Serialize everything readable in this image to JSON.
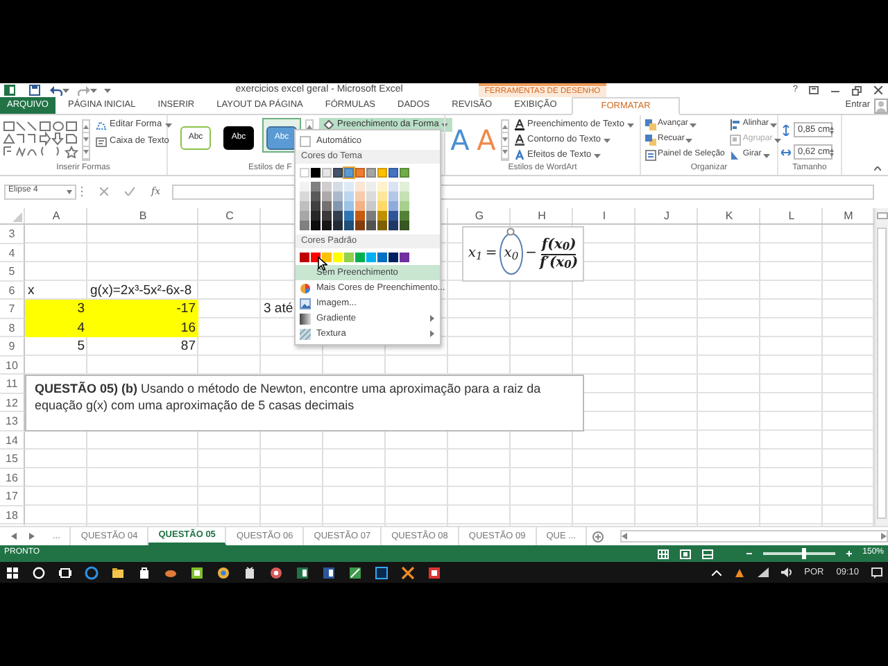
{
  "window": {
    "title": "exercicios excel geral - Microsoft Excel",
    "contextual_group": "FERRAMENTAS DE DESENHO",
    "help": "?"
  },
  "ribbon_tabs": [
    {
      "label": "ARQUIVO",
      "kind": "file",
      "selected": false
    },
    {
      "label": "PÁGINA INICIAL",
      "kind": "plain",
      "selected": false
    },
    {
      "label": "INSERIR",
      "kind": "plain",
      "selected": false
    },
    {
      "label": "LAYOUT DA PÁGINA",
      "kind": "plain",
      "selected": false
    },
    {
      "label": "FÓRMULAS",
      "kind": "plain",
      "selected": false
    },
    {
      "label": "DADOS",
      "kind": "plain",
      "selected": false
    },
    {
      "label": "REVISÃO",
      "kind": "plain",
      "selected": false
    },
    {
      "label": "EXIBIÇÃO",
      "kind": "plain",
      "selected": false
    },
    {
      "label": "FORMATAR",
      "kind": "contextual",
      "selected": true
    }
  ],
  "account": "Entrar",
  "insert_shapes": {
    "label": "Inserir Formas",
    "commands": [
      "Editar Forma",
      "Caixa de Texto"
    ]
  },
  "shape_styles": {
    "label": "Estilos de F",
    "presets": [
      {
        "text": "Abc",
        "kind": "outline",
        "selected": false
      },
      {
        "text": "Abc",
        "kind": "dark",
        "selected": false
      },
      {
        "text": "Abc",
        "kind": "blue",
        "selected": true
      }
    ],
    "fill_button": {
      "label": "Preenchimento da Forma",
      "expanded": true
    }
  },
  "wordart": {
    "label": "Estilos de WordArt",
    "presets": [
      {
        "text": "A",
        "color": "#4a8fd4"
      },
      {
        "text": "A",
        "color": "#ef8a4a"
      }
    ],
    "commands": [
      {
        "label": "Preenchimento de Texto",
        "kind": "fill"
      },
      {
        "label": "Contorno do Texto",
        "kind": "outline"
      },
      {
        "label": "Efeitos de Texto",
        "kind": "effects"
      }
    ]
  },
  "arrange": {
    "label": "Organizar",
    "commands": [
      {
        "label": "Avançar",
        "kind": "forward",
        "disabled": false,
        "dropdown": true
      },
      {
        "label": "Recuar",
        "kind": "backward",
        "disabled": false,
        "dropdown": true
      },
      {
        "label": "Painel de Seleção",
        "kind": "pane",
        "disabled": false,
        "dropdown": false
      },
      {
        "label": "Alinhar",
        "kind": "align",
        "disabled": false,
        "dropdown": true
      },
      {
        "label": "Agrupar",
        "kind": "group",
        "disabled": true,
        "dropdown": true
      },
      {
        "label": "Girar",
        "kind": "rotate",
        "disabled": false,
        "dropdown": true
      }
    ]
  },
  "size": {
    "label": "Tamanho",
    "fields": [
      {
        "value": "0,85 cm",
        "kind": "height"
      },
      {
        "value": "0,62 cm",
        "kind": "width"
      }
    ]
  },
  "name_box": "Elipse 4",
  "formula_bar": {
    "fx": "fx"
  },
  "columns": [
    "A",
    "B",
    "C",
    null,
    null,
    null,
    "G",
    "H",
    "I",
    "J",
    "K",
    "L",
    "M"
  ],
  "rows": [
    {
      "number": "3"
    },
    {
      "number": "4"
    },
    {
      "number": "5"
    },
    {
      "number": "6",
      "cells": {
        "A": {
          "text": "x",
          "kind": "text",
          "highlighted": false
        },
        "B": {
          "text": "g(x)=2x³-5x²-6x-8",
          "kind": "text",
          "highlighted": false
        }
      }
    },
    {
      "number": "7",
      "cells": {
        "A": {
          "text": "3",
          "kind": "number",
          "highlighted": true
        },
        "B": {
          "text": "-17",
          "kind": "number",
          "highlighted": true
        },
        "D": {
          "text": "3 até",
          "highlighted": false
        }
      }
    },
    {
      "number": "8",
      "cells": {
        "A": {
          "text": "4",
          "kind": "number",
          "highlighted": true
        },
        "B": {
          "text": "16",
          "kind": "number",
          "highlighted": true
        }
      }
    },
    {
      "number": "9",
      "cells": {
        "A": {
          "text": "5",
          "kind": "number",
          "highlighted": false
        },
        "B": {
          "text": "87",
          "kind": "number",
          "highlighted": false
        }
      }
    },
    {
      "number": "10"
    },
    {
      "number": "11"
    },
    {
      "number": "12"
    },
    {
      "number": "13"
    },
    {
      "number": "14"
    },
    {
      "number": "15"
    },
    {
      "number": "16"
    },
    {
      "number": "17"
    },
    {
      "number": "18"
    }
  ],
  "equation": {
    "lhs": "x$_{1}$",
    "equals": "=",
    "term": "x$_{0}$",
    "minus": "−",
    "numerator": "f(x$_{0}$)",
    "denominator": "f′(x$_{0}$)"
  },
  "question_box": {
    "text": "**QUESTÃO 05) (b)** Usando o método de Newton, encontre uma aproximação para a raiz da equação g(x) com uma aproximação de 5 casas decimais"
  },
  "fill_menu": {
    "items": [
      {
        "kind": "auto",
        "label": "Automático",
        "selected": false
      },
      {
        "kind": "heading",
        "label": "Cores do Tema"
      },
      {
        "kind": "theme_palette"
      },
      {
        "kind": "heading",
        "label": "Cores Padrão"
      },
      {
        "kind": "standard_palette"
      },
      {
        "kind": "none",
        "label": "Sem Preenchimento",
        "selected": true
      },
      {
        "kind": "more_colors",
        "label": "Mais Cores de Preenchimento...",
        "selected": false
      },
      {
        "kind": "picture",
        "label": "Imagem...",
        "selected": false
      },
      {
        "kind": "gradient",
        "label": "Gradiente",
        "selected": false,
        "submenu": true
      },
      {
        "kind": "texture",
        "label": "Textura",
        "selected": false,
        "submenu": true
      }
    ],
    "theme_colors": [
      {
        "color": "#ffffff",
        "selected": false,
        "shades": [
          {
            "color": "#f2f2f2"
          },
          {
            "color": "#d9d9d9"
          },
          {
            "color": "#bfbfbf"
          },
          {
            "color": "#a6a6a6"
          },
          {
            "color": "#808080"
          }
        ]
      },
      {
        "color": "#000000",
        "selected": false,
        "shades": [
          {
            "color": "#808080"
          },
          {
            "color": "#595959"
          },
          {
            "color": "#404040"
          },
          {
            "color": "#262626"
          },
          {
            "color": "#0d0d0d"
          }
        ]
      },
      {
        "color": "#e7e6e6",
        "selected": false,
        "shades": [
          {
            "color": "#d0cece"
          },
          {
            "color": "#aeaaaa"
          },
          {
            "color": "#757171"
          },
          {
            "color": "#3a3838"
          },
          {
            "color": "#171616"
          }
        ]
      },
      {
        "color": "#44546a",
        "selected": false,
        "shades": [
          {
            "color": "#d6dce4"
          },
          {
            "color": "#acb9ca"
          },
          {
            "color": "#8497b0"
          },
          {
            "color": "#333f4f"
          },
          {
            "color": "#222a35"
          }
        ]
      },
      {
        "color": "#5b9bd5",
        "selected": true,
        "shades": [
          {
            "color": "#deebf6"
          },
          {
            "color": "#bdd7ee"
          },
          {
            "color": "#9dc3e6"
          },
          {
            "color": "#2e75b5"
          },
          {
            "color": "#1f4e79"
          }
        ]
      },
      {
        "color": "#ed7d31",
        "selected": false,
        "shades": [
          {
            "color": "#fbe5d5"
          },
          {
            "color": "#f7cbac"
          },
          {
            "color": "#f4b183"
          },
          {
            "color": "#c55a11"
          },
          {
            "color": "#843c0b"
          }
        ]
      },
      {
        "color": "#a5a5a5",
        "selected": false,
        "shades": [
          {
            "color": "#ededed"
          },
          {
            "color": "#dbdbdb"
          },
          {
            "color": "#c9c9c9"
          },
          {
            "color": "#7b7b7b"
          },
          {
            "color": "#525252"
          }
        ]
      },
      {
        "color": "#ffc000",
        "selected": false,
        "shades": [
          {
            "color": "#fff2cc"
          },
          {
            "color": "#ffe699"
          },
          {
            "color": "#ffd966"
          },
          {
            "color": "#bf9000"
          },
          {
            "color": "#7f6000"
          }
        ]
      },
      {
        "color": "#4472c4",
        "selected": false,
        "shades": [
          {
            "color": "#dae3f3"
          },
          {
            "color": "#b4c7e7"
          },
          {
            "color": "#8faadc"
          },
          {
            "color": "#2f5597"
          },
          {
            "color": "#1f3864"
          }
        ]
      },
      {
        "color": "#70ad47",
        "selected": false,
        "shades": [
          {
            "color": "#e2efd9"
          },
          {
            "color": "#c5e0b3"
          },
          {
            "color": "#a8d08d"
          },
          {
            "color": "#538135"
          },
          {
            "color": "#375623"
          }
        ]
      }
    ],
    "standard_colors": [
      {
        "color": "#c00000"
      },
      {
        "color": "#ff0000"
      },
      {
        "color": "#ffc000"
      },
      {
        "color": "#ffff00"
      },
      {
        "color": "#92d050"
      },
      {
        "color": "#00b050"
      },
      {
        "color": "#00b0f0"
      },
      {
        "color": "#0070c0"
      },
      {
        "color": "#002060"
      },
      {
        "color": "#7030a0"
      }
    ]
  },
  "sheet_tabs": {
    "more": "...",
    "tabs": [
      {
        "label": "QUESTÃO 04",
        "selected": false
      },
      {
        "label": "QUESTÃO 05",
        "selected": true
      },
      {
        "label": "QUESTÃO 06",
        "selected": false
      },
      {
        "label": "QUESTÃO 07",
        "selected": false
      },
      {
        "label": "QUESTÃO 08",
        "selected": false
      },
      {
        "label": "QUESTÃO 09",
        "selected": false
      },
      {
        "label": "QUE ...",
        "selected": false
      }
    ]
  },
  "status_bar": {
    "status": "PRONTO",
    "zoom": "150%",
    "zoom_level": {
      "level": 0.57
    }
  },
  "taskbar": {
    "language": "POR",
    "time": "09:10"
  }
}
